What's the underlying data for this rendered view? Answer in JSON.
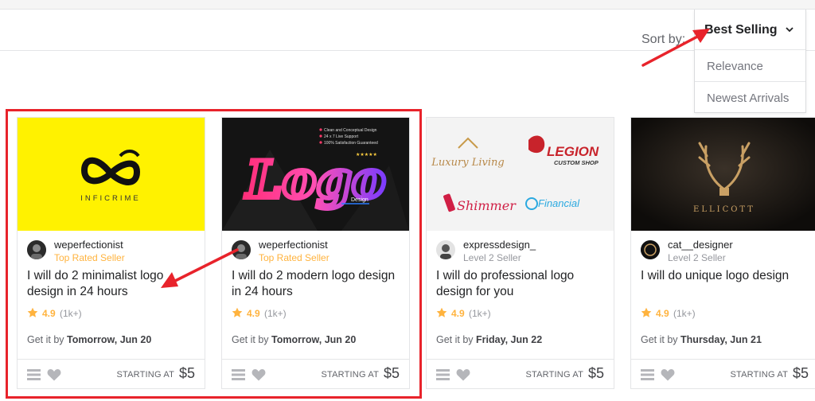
{
  "sort": {
    "label": "Sort by:",
    "selected": "Best Selling",
    "options": [
      "Relevance",
      "Newest Arrivals"
    ]
  },
  "gigs": [
    {
      "image_text": "INFICRIME",
      "seller": "weperfectionist",
      "level": "Top Rated Seller",
      "title": "I will do 2 minimalist logo design in 24 hours",
      "rating": "4.9",
      "count": "(1k+)",
      "delivery_prefix": "Get it by",
      "delivery_date": "Tomorrow, Jun 20",
      "starting": "STARTING AT",
      "price": "$5"
    },
    {
      "image_text": "Logo",
      "image_sub": "Design",
      "image_bullets": [
        "Clean and Conceptual Design",
        "24 x 7 Live Support",
        "100% Satisfaction Guaranteed"
      ],
      "seller": "weperfectionist",
      "level": "Top Rated Seller",
      "title": "I will do 2 modern logo design in 24 hours",
      "rating": "4.9",
      "count": "(1k+)",
      "delivery_prefix": "Get it by",
      "delivery_date": "Tomorrow, Jun 20",
      "starting": "STARTING AT",
      "price": "$5"
    },
    {
      "image_logos": [
        "Luxury Living",
        "LEGION",
        "CUSTOM SHOP",
        "Shimmer",
        "Financial"
      ],
      "seller": "expressdesign_",
      "level": "Level 2 Seller",
      "title": "I will do professional logo design for you",
      "rating": "4.9",
      "count": "(1k+)",
      "delivery_prefix": "Get it by",
      "delivery_date": "Friday, Jun 22",
      "starting": "STARTING AT",
      "price": "$5"
    },
    {
      "image_text": "ELLICOTT",
      "seller": "cat__designer",
      "level": "Level 2 Seller",
      "title": "I will do unique logo design",
      "rating": "4.9",
      "count": "(1k+)",
      "delivery_prefix": "Get it by",
      "delivery_date": "Thursday, Jun 21",
      "starting": "STARTING AT",
      "price": "$5"
    }
  ],
  "colors": {
    "annotation": "#e8232b",
    "star": "#ffb33e",
    "top_rated": "#ffb33e"
  },
  "icons": [
    "chevron-down-icon",
    "star-icon",
    "list-icon",
    "heart-icon"
  ]
}
